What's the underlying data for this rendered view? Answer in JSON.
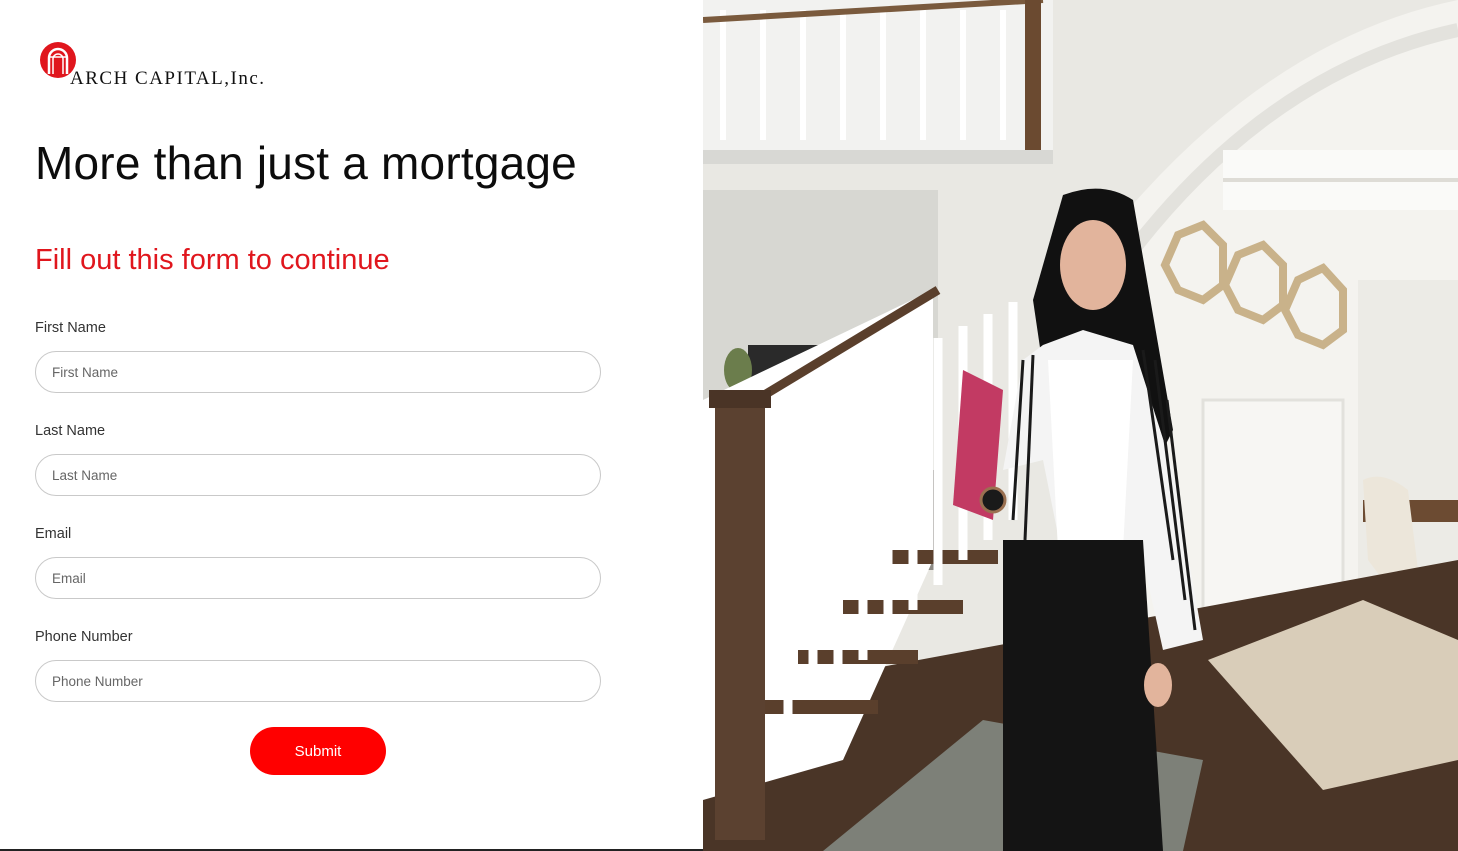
{
  "brand": {
    "name": "ARCH CAPITAL,Inc.",
    "color": "#e0161d"
  },
  "hero": {
    "headline": "More than just a mortgage",
    "subheadline": "Fill out this form to continue"
  },
  "form": {
    "fields": [
      {
        "label": "First Name",
        "placeholder": "First Name",
        "value": ""
      },
      {
        "label": "Last Name",
        "placeholder": "Last Name",
        "value": ""
      },
      {
        "label": "Email",
        "placeholder": "Email",
        "value": ""
      },
      {
        "label": "Phone Number",
        "placeholder": "Phone Number",
        "value": ""
      }
    ],
    "submit_label": "Submit",
    "submit_color": "#ff0000"
  }
}
